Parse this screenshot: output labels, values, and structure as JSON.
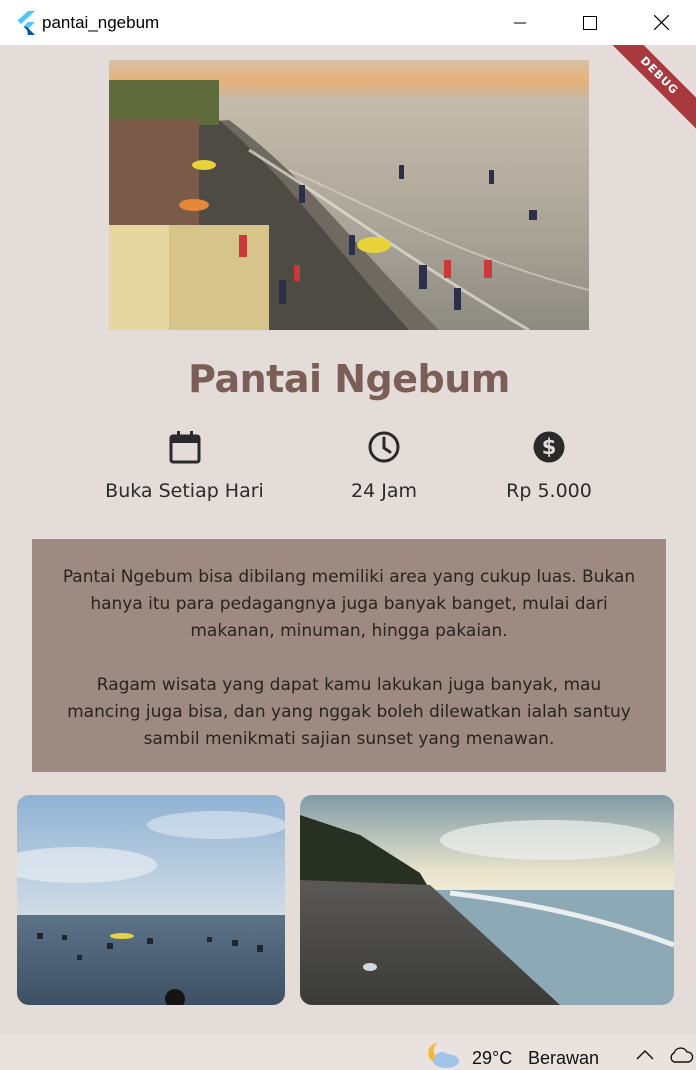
{
  "window": {
    "title": "pantai_ngebum"
  },
  "debug_banner": "DEBUG",
  "place": {
    "title": "Pantai Ngebum",
    "info": [
      {
        "icon": "calendar-icon",
        "label": "Buka Setiap Hari"
      },
      {
        "icon": "clock-icon",
        "label": "24 Jam"
      },
      {
        "icon": "dollar-icon",
        "label": "Rp 5.000"
      }
    ],
    "description": [
      "Pantai Ngebum bisa dibilang memiliki area yang cukup luas. Bukan hanya itu para pedagangnya juga banyak banget, mulai dari makanan, minuman, hingga pakaian.",
      "Ragam wisata yang dapat kamu lakukan juga banyak, mau mancing juga bisa, dan yang nggak boleh dilewatkan ialah santuy sambil menikmati sajian sunset yang menawan."
    ]
  },
  "taskbar": {
    "temperature": "29°C",
    "condition": "Berawan"
  },
  "colors": {
    "title": "#7b5e55",
    "background": "#e4dcd9",
    "description_box": "#9d8a82",
    "debug_ribbon": "#a83a3f"
  }
}
